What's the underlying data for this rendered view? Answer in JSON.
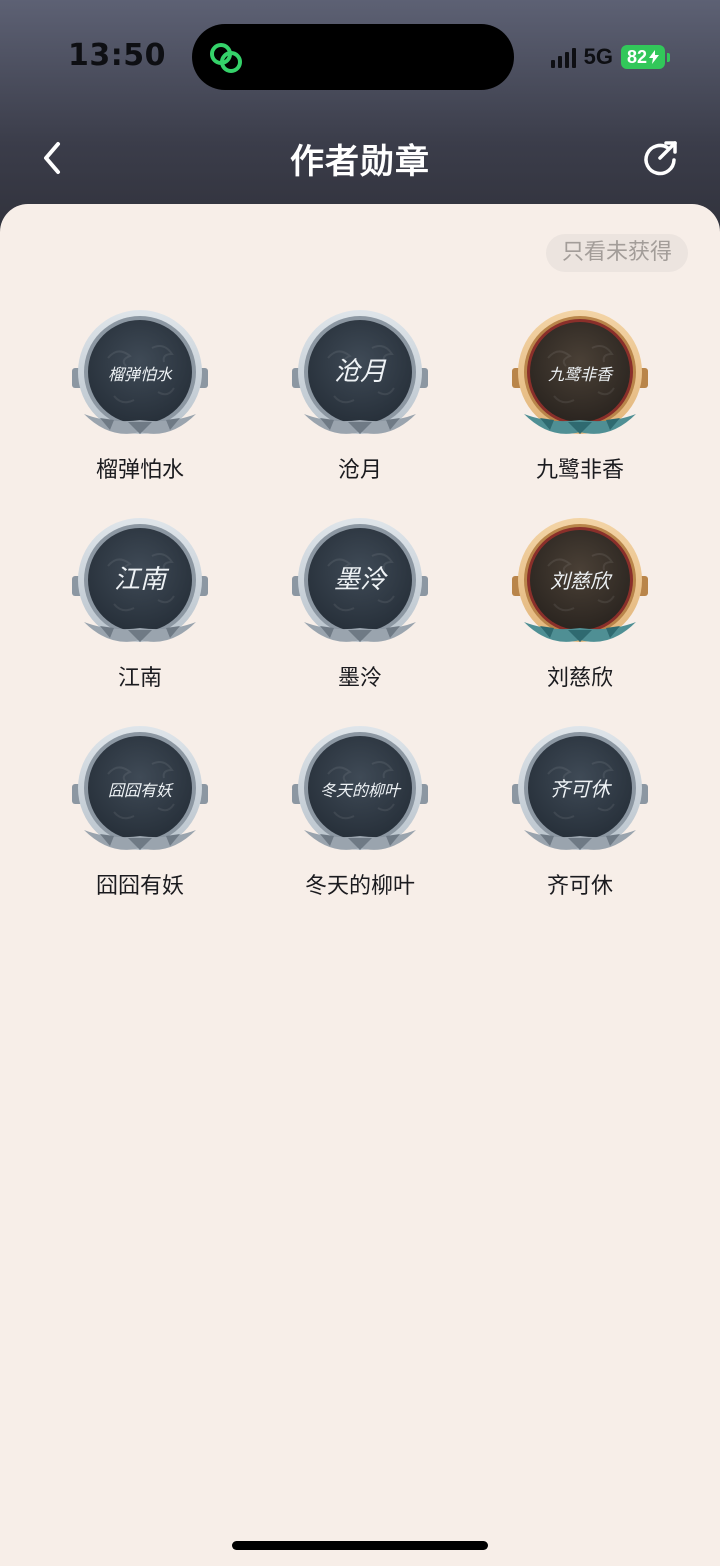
{
  "status_bar": {
    "time": "13:50",
    "network": "5G",
    "battery": "82"
  },
  "nav": {
    "title": "作者勋章"
  },
  "filter": {
    "label": "只看未获得"
  },
  "medals": [
    {
      "name": "榴弹怕水",
      "signature": "榴弹怕水",
      "tier": "silver"
    },
    {
      "name": "沧月",
      "signature": "沧月",
      "tier": "silver"
    },
    {
      "name": "九鹭非香",
      "signature": "九鹭非香",
      "tier": "gold"
    },
    {
      "name": "江南",
      "signature": "江南",
      "tier": "silver"
    },
    {
      "name": "墨泠",
      "signature": "墨泠",
      "tier": "silver"
    },
    {
      "name": "刘慈欣",
      "signature": "刘慈欣",
      "tier": "gold"
    },
    {
      "name": "囧囧有妖",
      "signature": "囧囧有妖",
      "tier": "silver"
    },
    {
      "name": "冬天的柳叶",
      "signature": "冬天的柳叶",
      "tier": "silver"
    },
    {
      "name": "齐可休",
      "signature": "齐可休",
      "tier": "silver"
    }
  ],
  "colors": {
    "accent_green": "#32c75a",
    "sheet_bg": "#f7eee8",
    "header_bg": "#3b3d4a",
    "silver_rim": "#b9c3cc",
    "gold_rim": "#e2b57a",
    "teal_leaf": "#4f8f94"
  }
}
